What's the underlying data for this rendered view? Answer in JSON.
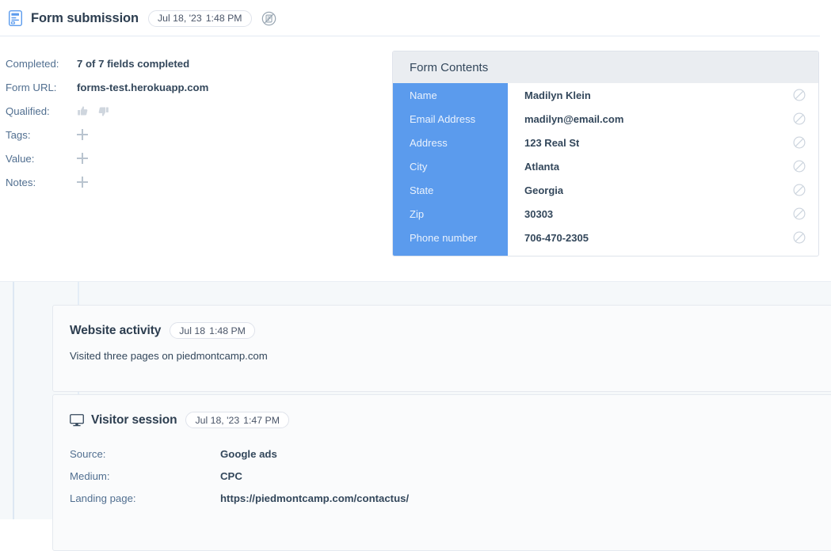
{
  "header": {
    "icon": "form-icon",
    "title": "Form submission",
    "timestamp_date": "Jul 18, '23",
    "timestamp_time": "1:48 PM",
    "action_icon": "no-form-icon"
  },
  "properties": [
    {
      "label": "Completed:",
      "value": "7 of 7 fields completed",
      "kind": "text"
    },
    {
      "label": "Form URL:",
      "value": "forms-test.herokuapp.com",
      "kind": "text"
    },
    {
      "label": "Qualified:",
      "value": "",
      "kind": "thumbs"
    },
    {
      "label": "Tags:",
      "value": "",
      "kind": "plus"
    },
    {
      "label": "Value:",
      "value": "",
      "kind": "plus"
    },
    {
      "label": "Notes:",
      "value": "",
      "kind": "plus"
    }
  ],
  "form_contents": {
    "title": "Form Contents",
    "row_action_icon": "block-icon",
    "rows": [
      {
        "key": "Name",
        "value": "Madilyn Klein"
      },
      {
        "key": "Email Address",
        "value": "madilyn@email.com"
      },
      {
        "key": "Address",
        "value": "123 Real St"
      },
      {
        "key": "City",
        "value": "Atlanta"
      },
      {
        "key": "State",
        "value": "Georgia"
      },
      {
        "key": "Zip",
        "value": "30303"
      },
      {
        "key": "Phone number",
        "value": "706-470-2305"
      }
    ]
  },
  "timeline": {
    "website_activity": {
      "title": "Website activity",
      "timestamp_date": "Jul 18",
      "timestamp_time": "1:48 PM",
      "description": "Visited three pages on piedmontcamp.com"
    },
    "visitor_session": {
      "icon": "monitor-icon",
      "title": "Visitor session",
      "timestamp_date": "Jul 18, '23",
      "timestamp_time": "1:47 PM",
      "rows": [
        {
          "label": "Source:",
          "value": "Google ads"
        },
        {
          "label": "Medium:",
          "value": "CPC"
        },
        {
          "label": "Landing page:",
          "value": "https://piedmontcamp.com/contactus/"
        }
      ]
    }
  },
  "colors": {
    "accent_blue": "#5b9bed",
    "header_bg": "#eaedf1",
    "timeline_bg": "#f5f8fa",
    "text_primary": "#33475b",
    "text_muted": "#516f90"
  }
}
